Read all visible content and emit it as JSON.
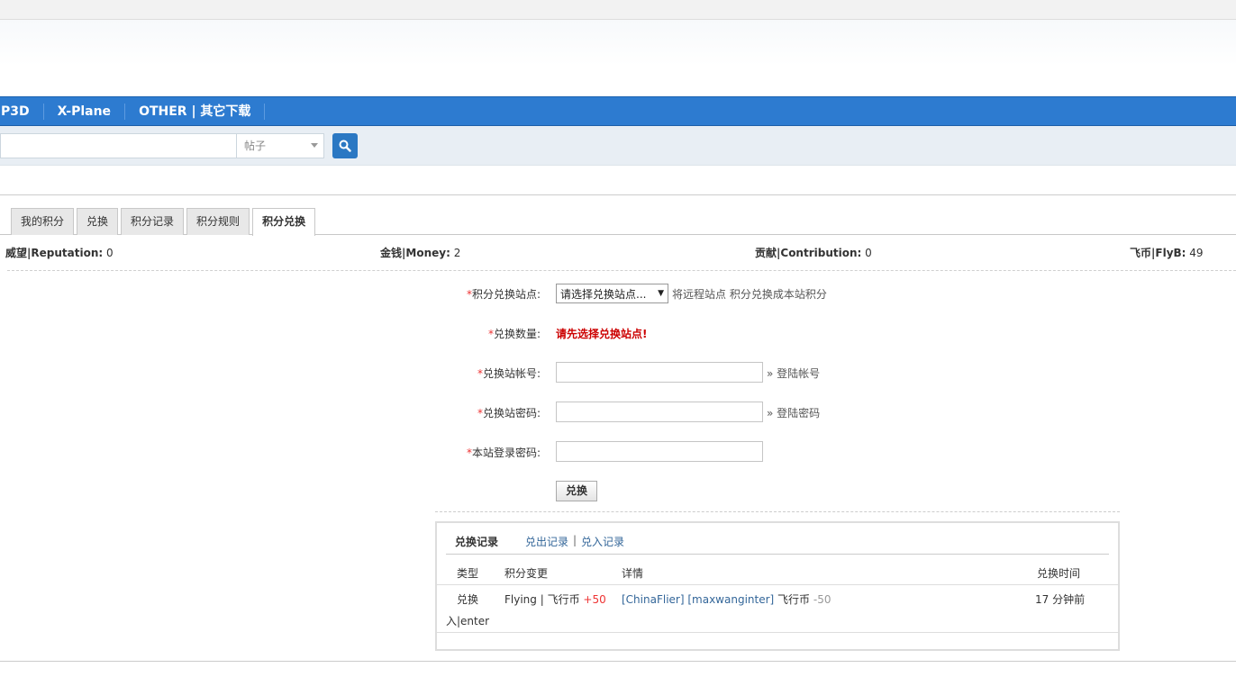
{
  "nav": {
    "items": [
      "/ P3D",
      "X-Plane",
      "OTHER | 其它下载"
    ]
  },
  "search": {
    "type_label": "帖子",
    "button_icon": "search-icon"
  },
  "tabs": [
    {
      "label": "我的积分",
      "active": false
    },
    {
      "label": "兑换",
      "active": false
    },
    {
      "label": "积分记录",
      "active": false
    },
    {
      "label": "积分规则",
      "active": false
    },
    {
      "label": "积分兑换",
      "active": true
    }
  ],
  "stats": {
    "reputation": {
      "label": "威望|Reputation:",
      "value": "0"
    },
    "money": {
      "label": "金钱|Money:",
      "value": "2"
    },
    "contribution": {
      "label": "贡献|Contribution:",
      "value": "0"
    },
    "flyb": {
      "label": "飞币|FlyB:",
      "value": "49"
    }
  },
  "form": {
    "required_mark": "*",
    "site_label": "积分兑换站点:",
    "site_select": "请选择兑换站点...",
    "site_hint": "将远程站点 积分兑换成本站积分",
    "amount_label": "兑换数量:",
    "amount_warning": "请先选择兑换站点!",
    "account_label": "兑换站帐号:",
    "account_hint": "» 登陆帐号",
    "password_label": "兑换站密码:",
    "password_hint": "» 登陆密码",
    "local_password_label": "本站登录密码:",
    "submit": "兑换"
  },
  "records": {
    "tab_current": "兑换记录",
    "tab_out": "兑出记录",
    "separator": "|",
    "tab_in": "兑入记录",
    "headers": {
      "type": "类型",
      "change": "积分变更",
      "detail": "详情",
      "time": "兑换时间"
    },
    "row": {
      "type_line1": "兑换",
      "type_line2": "入|enter",
      "change_name": "Flying | 飞行币",
      "change_value": "+50",
      "detail_site": "[ChinaFlier]",
      "detail_user": "[maxwanginter]",
      "detail_currency": "飞行币",
      "detail_value": "-50",
      "time": "17 分钟前"
    }
  },
  "colors": {
    "nav_bg": "#2d7bd0",
    "search_button": "#2b78c3",
    "warning": "#cc0000",
    "link": "#336699"
  }
}
